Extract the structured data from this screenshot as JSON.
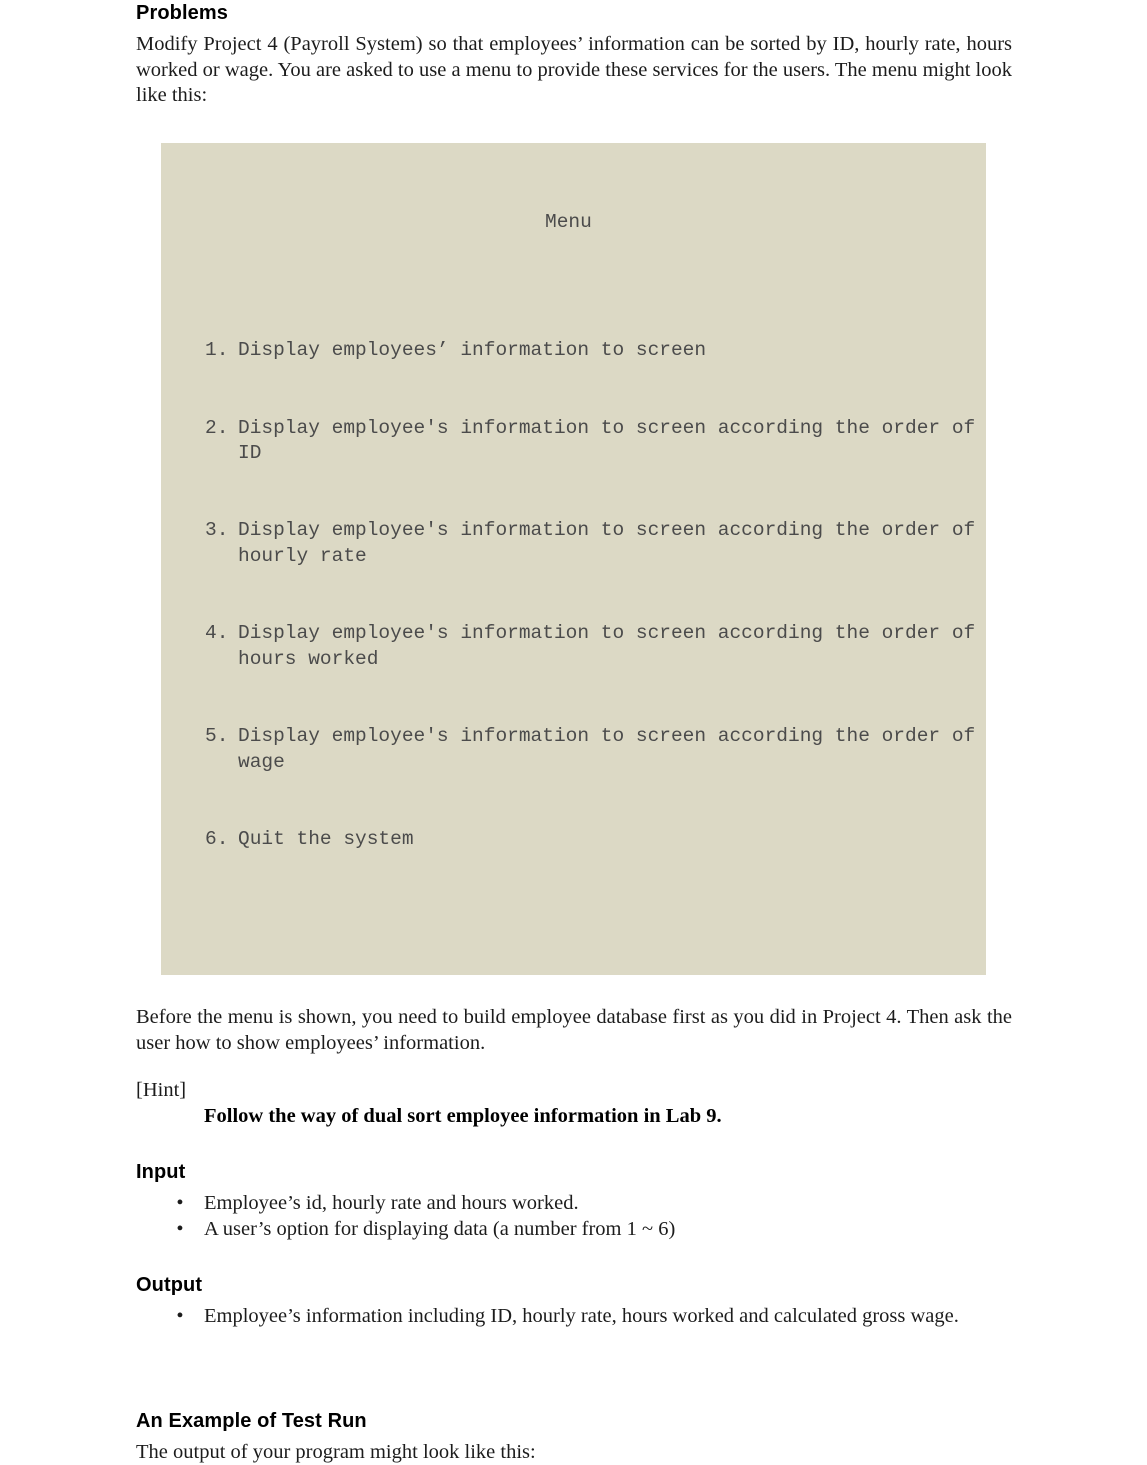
{
  "document": {
    "sections": {
      "problems": {
        "heading": "Problems",
        "paragraph": "Modify Project 4 (Payroll System) so that employees’ information can be sorted by ID, hourly rate, hours worked or wage. You are asked to use a menu to provide these services for the users. The menu might look like this:"
      },
      "menu_block": {
        "title": "Menu",
        "items": [
          {
            "number": "1.",
            "text": "Display employees’ information to screen"
          },
          {
            "number": "2.",
            "text": "Display employee's information to screen according the order of ID"
          },
          {
            "number": "3.",
            "text": "Display employee's information to screen according the order of hourly rate"
          },
          {
            "number": "4.",
            "text": "Display employee's information to screen according the order of hours worked"
          },
          {
            "number": "5.",
            "text": "Display employee's information to screen according the order of wage"
          },
          {
            "number": "6.",
            "text": "Quit the system"
          }
        ]
      },
      "before_menu": {
        "paragraph": "Before the menu is shown, you need to build employee database first as you did in Project 4. Then ask the user how to show employees’ information."
      },
      "hint": {
        "label": "[Hint]",
        "text": "Follow the way of dual sort employee information in Lab 9."
      },
      "input": {
        "heading": "Input",
        "bullet_marker": "•",
        "items": [
          "Employee’s id, hourly rate and hours worked.",
          "A user’s option for displaying data (a number from 1 ~ 6)"
        ]
      },
      "output": {
        "heading": "Output",
        "bullet_marker": "•",
        "items": [
          "Employee’s information including ID, hourly rate, hours worked and calculated gross wage."
        ]
      },
      "test_run": {
        "heading": "An Example of Test Run",
        "paragraph": "The output of your program might look like this:"
      }
    },
    "colors": {
      "code_background": "#dcd9c5",
      "code_text": "#4b4b4b",
      "body_text": "#1c1c1c",
      "page_background": "#ffffff"
    }
  }
}
